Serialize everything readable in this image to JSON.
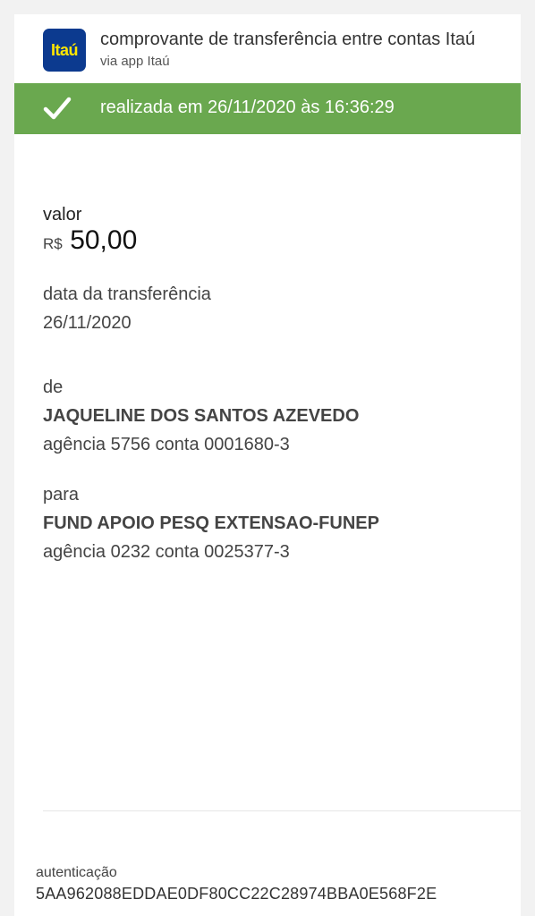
{
  "header": {
    "logo_text": "Itaú",
    "title": "comprovante de transferência entre contas Itaú",
    "subtitle": "via app Itaú"
  },
  "status": {
    "icon": "checkmark-icon",
    "text": "realizada em 26/11/2020 às 16:36:29",
    "color": "#6aa84f"
  },
  "valor": {
    "label": "valor",
    "currency": "R$",
    "amount": "50,00"
  },
  "data_transferencia": {
    "label": "data da transferência",
    "value": "26/11/2020"
  },
  "de": {
    "label": "de",
    "name": "JAQUELINE DOS SANTOS AZEVEDO",
    "account": "agência 5756 conta 0001680-3"
  },
  "para": {
    "label": "para",
    "name": "FUND APOIO PESQ EXTENSAO-FUNEP",
    "account": "agência 0232 conta 0025377-3"
  },
  "autenticacao": {
    "label": "autenticação",
    "code": "5AA962088EDDAE0DF80CC22C28974BBA0E568F2E"
  },
  "colors": {
    "brand_blue": "#0c3a8f",
    "brand_yellow": "#ffe600",
    "success_green": "#6aa84f"
  }
}
